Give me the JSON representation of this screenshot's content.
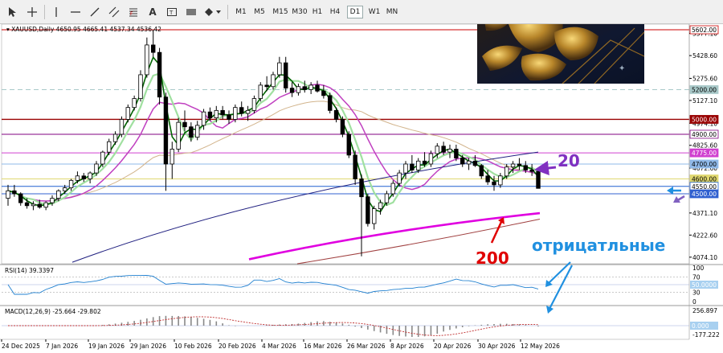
{
  "toolbar": {
    "timeframes": [
      "M1",
      "M5",
      "M15",
      "M30",
      "H1",
      "H4",
      "D1",
      "W1",
      "MN"
    ],
    "active_timeframe": "D1",
    "tools": [
      "cursor-icon",
      "crosshair-icon",
      "vertical-line-icon",
      "horizontal-line-icon",
      "trend-line-icon",
      "channel-icon",
      "fibonacci-icon",
      "text-icon",
      "label-icon",
      "rectangle-icon",
      "shapes-icon"
    ]
  },
  "chart_info": {
    "symbol_line": "XAUUSD,Daily  4650.95 4665.41 4537.34 4536.42"
  },
  "price_axis": {
    "ticks": [
      "5577.10",
      "5428.60",
      "5275.60",
      "5127.10",
      "4974.10",
      "4825.60",
      "4672.60",
      "4371.10",
      "4222.60",
      "4074.10"
    ],
    "badges": [
      {
        "text": "5602.00",
        "bg": "#ffffff",
        "fg": "#000000",
        "border": "#cc0000",
        "value": 5602
      },
      {
        "text": "5200.00",
        "bg": "#a9c9c9",
        "fg": "#000000",
        "value": 5200
      },
      {
        "text": "5000.00",
        "bg": "#990000",
        "fg": "#ffffff",
        "value": 5000
      },
      {
        "text": "4900.00",
        "bg": "#ffffff",
        "fg": "#000000",
        "border": "#800080",
        "value": 4900
      },
      {
        "text": "4775.00",
        "bg": "#d040d0",
        "fg": "#ffffff",
        "value": 4775
      },
      {
        "text": "4700.00",
        "bg": "#8fb8e8",
        "fg": "#000000",
        "value": 4700
      },
      {
        "text": "4600.00",
        "bg": "#e0d870",
        "fg": "#000000",
        "value": 4600
      },
      {
        "text": "4550.00",
        "bg": "#ffffff",
        "fg": "#000000",
        "border": "#2060d0",
        "value": 4550
      },
      {
        "text": "4500.00",
        "bg": "#3060d0",
        "fg": "#ffffff",
        "value": 4500
      }
    ]
  },
  "date_axis": {
    "labels": [
      "24 Dec 2025",
      "7 Jan 2026",
      "19 Jan 2026",
      "29 Jan 2026",
      "10 Feb 2026",
      "20 Feb 2026",
      "4 Mar 2026",
      "16 Mar 2026",
      "26 Mar 2026",
      "8 Apr 2026",
      "20 Apr 2026",
      "30 Apr 2026",
      "12 May 2026"
    ]
  },
  "annotations": {
    "ma20_label": "20",
    "ma200_label": "200",
    "comment": "отрицатльные"
  },
  "rsi": {
    "title": "RSI(14) 39.3397",
    "ticks": [
      "100",
      "70",
      "30",
      "0"
    ],
    "badge": "50.0000"
  },
  "macd": {
    "title": "MACD(12,26,9) -25.664 -29.802",
    "ticks": [
      "256.897",
      "-177.222"
    ],
    "badge": "0.000"
  },
  "colors": {
    "candle": "#000000",
    "ma_short": "#006400",
    "ma_light": "#a0e0a0",
    "ma_magenta": "#c040c0",
    "ma_tan": "#d2b48c",
    "ma_navy": "#202080",
    "ma200": "#e000e0",
    "ma_brown": "#a04040",
    "accent_purple": "#8030c0",
    "accent_red": "#e00000",
    "accent_blue": "#2090e0"
  },
  "chart_data": {
    "type": "candlestick",
    "symbol": "XAUUSD",
    "timeframe": "Daily",
    "last_ohlc": {
      "open": 4650.95,
      "high": 4665.41,
      "low": 4537.34,
      "close": 4536.42
    },
    "price_range": [
      4030,
      5640
    ],
    "candles": [
      [
        4470,
        4560,
        4420,
        4520
      ],
      [
        4520,
        4560,
        4480,
        4500
      ],
      [
        4500,
        4510,
        4420,
        4440
      ],
      [
        4440,
        4470,
        4400,
        4420
      ],
      [
        4420,
        4450,
        4390,
        4430
      ],
      [
        4430,
        4460,
        4400,
        4410
      ],
      [
        4410,
        4450,
        4390,
        4440
      ],
      [
        4440,
        4490,
        4420,
        4470
      ],
      [
        4470,
        4530,
        4450,
        4520
      ],
      [
        4520,
        4560,
        4500,
        4540
      ],
      [
        4540,
        4600,
        4520,
        4590
      ],
      [
        4590,
        4650,
        4570,
        4620
      ],
      [
        4620,
        4640,
        4580,
        4600
      ],
      [
        4600,
        4650,
        4570,
        4640
      ],
      [
        4640,
        4720,
        4620,
        4700
      ],
      [
        4700,
        4790,
        4680,
        4780
      ],
      [
        4780,
        4870,
        4760,
        4850
      ],
      [
        4850,
        4920,
        4830,
        4900
      ],
      [
        4900,
        5020,
        4880,
        5000
      ],
      [
        5000,
        5100,
        4980,
        5080
      ],
      [
        5080,
        5160,
        5060,
        5140
      ],
      [
        5140,
        5330,
        5120,
        5300
      ],
      [
        5300,
        5550,
        5280,
        5500
      ],
      [
        5500,
        5602,
        5420,
        5450
      ],
      [
        5450,
        5480,
        5100,
        5150
      ],
      [
        5150,
        5180,
        4520,
        4700
      ],
      [
        4700,
        4850,
        4600,
        4800
      ],
      [
        4800,
        5010,
        4780,
        4980
      ],
      [
        4980,
        5060,
        4920,
        4950
      ],
      [
        4950,
        4980,
        4850,
        4880
      ],
      [
        4880,
        4990,
        4860,
        4960
      ],
      [
        4960,
        5070,
        4930,
        5050
      ],
      [
        5050,
        5080,
        4990,
        5010
      ],
      [
        5010,
        5090,
        4980,
        5060
      ],
      [
        5060,
        5090,
        5000,
        5030
      ],
      [
        5030,
        5060,
        4970,
        5000
      ],
      [
        5000,
        5100,
        4980,
        5080
      ],
      [
        5080,
        5120,
        5020,
        5040
      ],
      [
        5040,
        5090,
        4990,
        5060
      ],
      [
        5060,
        5160,
        5040,
        5140
      ],
      [
        5140,
        5250,
        5120,
        5230
      ],
      [
        5230,
        5290,
        5190,
        5220
      ],
      [
        5220,
        5320,
        5200,
        5300
      ],
      [
        5300,
        5420,
        5280,
        5380
      ],
      [
        5380,
        5420,
        5180,
        5210
      ],
      [
        5210,
        5250,
        5150,
        5180
      ],
      [
        5180,
        5240,
        5160,
        5220
      ],
      [
        5220,
        5260,
        5180,
        5200
      ],
      [
        5200,
        5250,
        5170,
        5230
      ],
      [
        5230,
        5260,
        5180,
        5190
      ],
      [
        5190,
        5230,
        5140,
        5160
      ],
      [
        5160,
        5180,
        5040,
        5060
      ],
      [
        5060,
        5080,
        4980,
        5000
      ],
      [
        5000,
        5020,
        4880,
        4900
      ],
      [
        4900,
        4920,
        4740,
        4760
      ],
      [
        4760,
        4790,
        4560,
        4600
      ],
      [
        4600,
        4630,
        4080,
        4480
      ],
      [
        4480,
        4500,
        4280,
        4300
      ],
      [
        4300,
        4420,
        4260,
        4400
      ],
      [
        4400,
        4460,
        4360,
        4440
      ],
      [
        4440,
        4520,
        4420,
        4500
      ],
      [
        4500,
        4590,
        4480,
        4570
      ],
      [
        4570,
        4660,
        4550,
        4640
      ],
      [
        4640,
        4720,
        4600,
        4700
      ],
      [
        4700,
        4760,
        4640,
        4660
      ],
      [
        4660,
        4740,
        4640,
        4720
      ],
      [
        4720,
        4780,
        4680,
        4700
      ],
      [
        4700,
        4790,
        4680,
        4770
      ],
      [
        4770,
        4840,
        4740,
        4820
      ],
      [
        4820,
        4850,
        4760,
        4780
      ],
      [
        4780,
        4830,
        4740,
        4800
      ],
      [
        4800,
        4830,
        4720,
        4740
      ],
      [
        4740,
        4760,
        4680,
        4700
      ],
      [
        4700,
        4740,
        4660,
        4720
      ],
      [
        4720,
        4760,
        4680,
        4690
      ],
      [
        4690,
        4700,
        4600,
        4620
      ],
      [
        4620,
        4660,
        4560,
        4580
      ],
      [
        4580,
        4620,
        4520,
        4560
      ],
      [
        4560,
        4640,
        4540,
        4620
      ],
      [
        4620,
        4700,
        4600,
        4680
      ],
      [
        4680,
        4720,
        4640,
        4700
      ],
      [
        4700,
        4740,
        4660,
        4690
      ],
      [
        4690,
        4720,
        4640,
        4660
      ],
      [
        4660,
        4700,
        4620,
        4650
      ],
      [
        4650.95,
        4665.41,
        4537.34,
        4536.42
      ]
    ]
  }
}
